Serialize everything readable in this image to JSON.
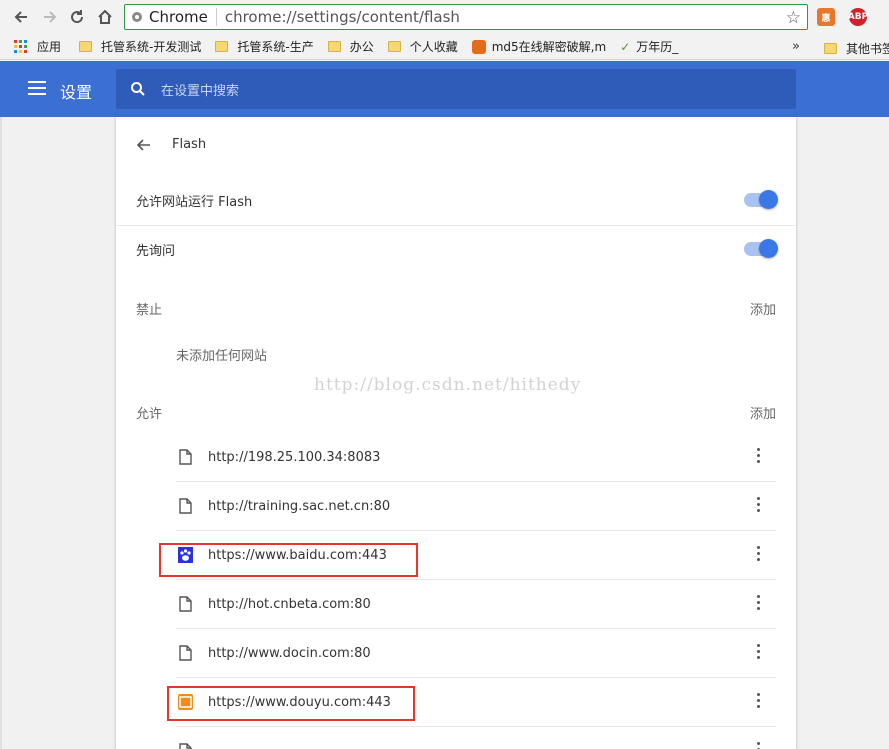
{
  "browser": {
    "omnibox_label": "Chrome",
    "url": "chrome://settings/content/flash"
  },
  "bookmarks": [
    {
      "label": "应用"
    },
    {
      "label": "托管系统-开发测试"
    },
    {
      "label": "托管系统-生产"
    },
    {
      "label": "办公"
    },
    {
      "label": "个人收藏"
    },
    {
      "label": "md5在线解密破解,m"
    },
    {
      "label": "万年历_"
    }
  ],
  "bookmarks_overflow": "»",
  "bookmarks_other": "其他书签",
  "header": {
    "title": "设置",
    "search_placeholder": "在设置中搜索"
  },
  "page": {
    "title": "Flash",
    "allow_flash_label": "允许网站运行 Flash",
    "ask_first_label": "先询问",
    "block_heading": "禁止",
    "block_add": "添加",
    "block_empty": "未添加任何网站",
    "allow_heading": "允许",
    "allow_add": "添加"
  },
  "allowed_sites": [
    {
      "url": "http://198.25.100.34:8083",
      "icon": "page-icon"
    },
    {
      "url": "http://training.sac.net.cn:80",
      "icon": "page-icon"
    },
    {
      "url": "https://www.baidu.com:443",
      "icon": "baidu-paw-icon"
    },
    {
      "url": "http://hot.cnbeta.com:80",
      "icon": "page-icon"
    },
    {
      "url": "http://www.docin.com:80",
      "icon": "page-icon"
    },
    {
      "url": "https://www.douyu.com:443",
      "icon": "douyu-icon"
    }
  ],
  "watermark": "http://blog.csdn.net/hithedy",
  "colors": {
    "header_blue": "#3b6fd1",
    "toggle_on": "#3b78e7",
    "highlight_red": "#e8332f"
  }
}
